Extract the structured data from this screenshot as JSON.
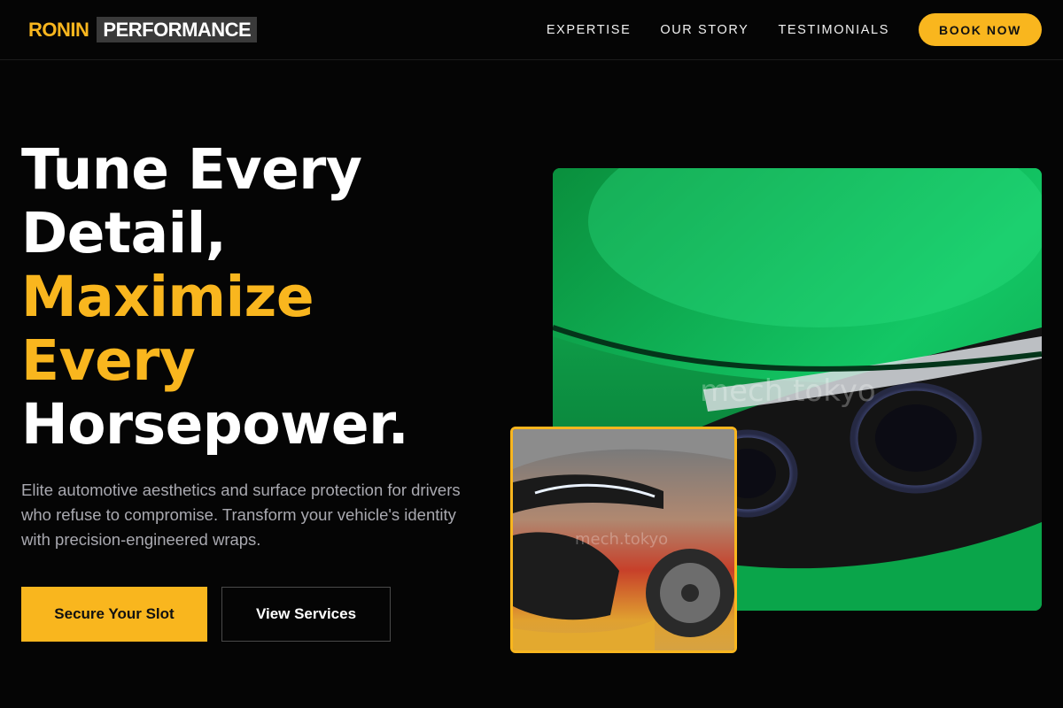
{
  "brand": {
    "part1": "RONIN",
    "part2": "PERFORMANCE"
  },
  "nav": {
    "links": [
      "EXPERTISE",
      "OUR STORY",
      "TESTIMONIALS"
    ],
    "cta": "BOOK NOW"
  },
  "hero": {
    "headline_white": [
      "Tune Every",
      "Detail,"
    ],
    "headline_gold": [
      "Maximize",
      "Every"
    ],
    "headline_end": "Horsepower.",
    "subtitle": "Elite automotive aesthetics and surface protection for drivers who refuse to compromise. Transform your vehicle's identity with precision-engineered wraps.",
    "primary_cta": "Secure Your Slot",
    "secondary_cta": "View Services"
  },
  "images": {
    "main_watermark": "mech.tokyo",
    "inset_watermark": "mech.tokyo"
  },
  "colors": {
    "accent": "#f9b61e",
    "background": "#050505",
    "wrap_green": "#0fae56"
  }
}
